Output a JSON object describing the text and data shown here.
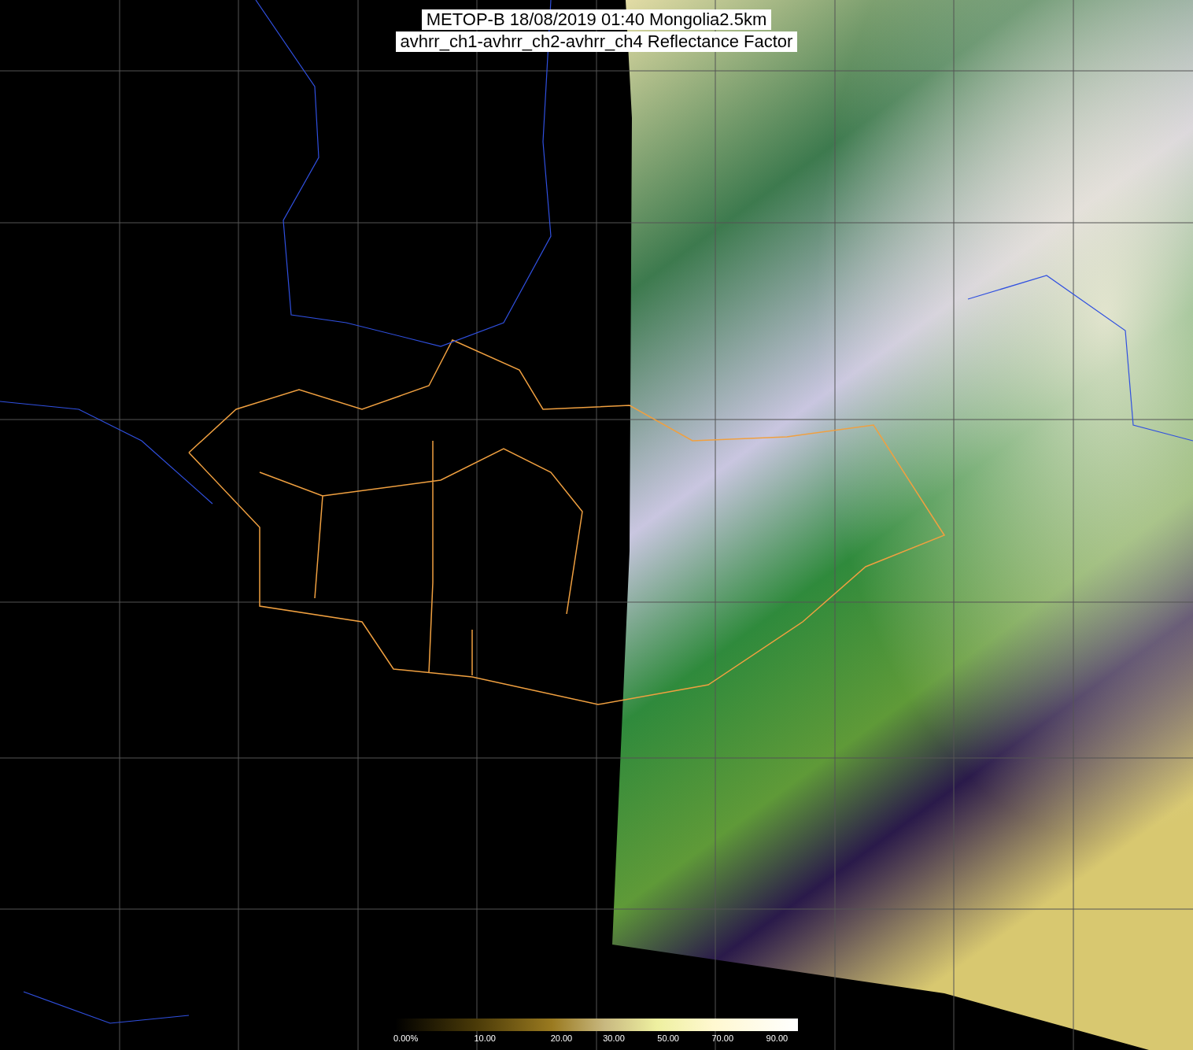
{
  "title": {
    "lines": [
      "METOP-B 18/08/2019 01:40 Mongolia2.5km",
      "avhrr_ch1-avhrr_ch2-avhrr_ch4 Reflectance Factor"
    ]
  },
  "colorbar": {
    "tick_labels": [
      "0.00%",
      "10.00",
      "20.00",
      "30.00",
      "50.00",
      "70.00",
      "90.00"
    ]
  }
}
